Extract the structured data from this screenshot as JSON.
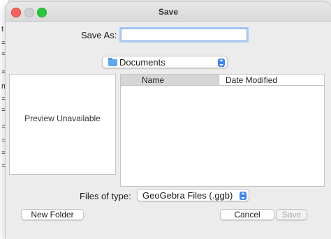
{
  "dialog": {
    "title": "Save",
    "save_as_label": "Save As:",
    "save_as_value": "",
    "location": "Documents",
    "preview_text": "Preview Unavailable",
    "columns": [
      "Name",
      "Date Modified"
    ],
    "files": [],
    "file_type_label": "Files of type:",
    "file_type_value": "GeoGebra Files (.ggb)",
    "buttons": {
      "new_folder": "New Folder",
      "cancel": "Cancel",
      "save": "Save"
    }
  },
  "background": {
    "fragments": [
      "t",
      "=",
      "=",
      "=",
      "m",
      "=",
      "=",
      "=",
      "=",
      "=",
      "="
    ]
  },
  "colors": {
    "close": "#ff5f57",
    "minimize": "#d0d0d0",
    "maximize": "#28c840",
    "accent": "#3a82f6"
  }
}
